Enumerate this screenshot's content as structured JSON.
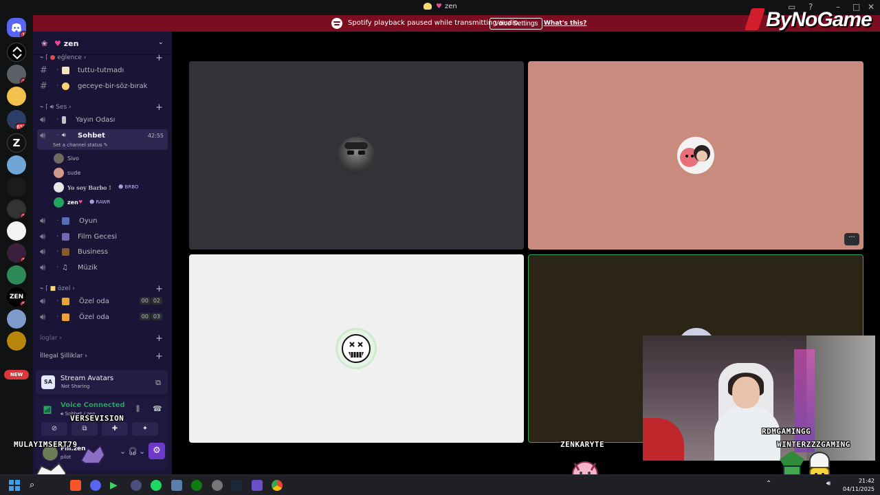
{
  "window": {
    "title": "zen"
  },
  "notice": {
    "message": "Spotify playback paused while transmitting audio.",
    "voice_settings": "Voice Settings",
    "whats_this": "What's this?"
  },
  "logo": "ByNoGame",
  "rail": {
    "badges": [
      "1",
      "1",
      "655",
      "2",
      "1",
      "2"
    ],
    "new_label": "NEW"
  },
  "guild": {
    "name": "zen"
  },
  "categories": {
    "eglence": "eğlence",
    "ses": "Ses",
    "ozel": "özel",
    "loglar": "loglar",
    "illegal": "İllegal Şilliklar"
  },
  "channels": {
    "tuttu": "tuttu-tutmadı",
    "geceye": "geceye-bir-söz-bırak",
    "yayin": "Yayın Odası",
    "sohbet": "Sohbet",
    "sohbet_timer": "42:55",
    "status_hint": "Set a channel status",
    "oyun": "Oyun",
    "film": "Film Gecesi",
    "business": "Business",
    "muzik": "Müzik",
    "ozel1": "Özel oda",
    "ozel1_limit": [
      "00",
      "02"
    ],
    "ozel2": "Özel oda",
    "ozel2_limit": [
      "00",
      "03"
    ]
  },
  "voice_users": [
    {
      "name": "Sivo",
      "tag": ""
    },
    {
      "name": "sude",
      "tag": ""
    },
    {
      "name": "Yo soy Barbo !",
      "tag": "BRBO"
    },
    {
      "name": "zen",
      "tag": "RAWR"
    }
  ],
  "stream_panel": {
    "title": "Stream Avatars",
    "subtitle": "Not Sharing"
  },
  "voice_panel": {
    "status": "Voice Connected",
    "location": "Sohbet / zen"
  },
  "user_panel": {
    "name": "Fill.zen",
    "status": "pilot"
  },
  "overlay": {
    "versevision": "VERSEVISION",
    "mulayim": "MULAYIMSERT79",
    "zenkaryte": "ZENKARYTE",
    "rdmgaming": "RDMGAMINGG",
    "winter": "WINTERZZZGAMING"
  },
  "taskbar": {
    "time": "21:42",
    "date": "04/11/2025"
  },
  "colors": {
    "sidebar": "#1a1437",
    "notice": "#7a0d1f",
    "voice_green": "#23a55a",
    "tile_dark": "#313338",
    "tile_pink": "#c98b7e",
    "tile_white": "#f0f0f0",
    "tile_brown": "#2b2518"
  }
}
